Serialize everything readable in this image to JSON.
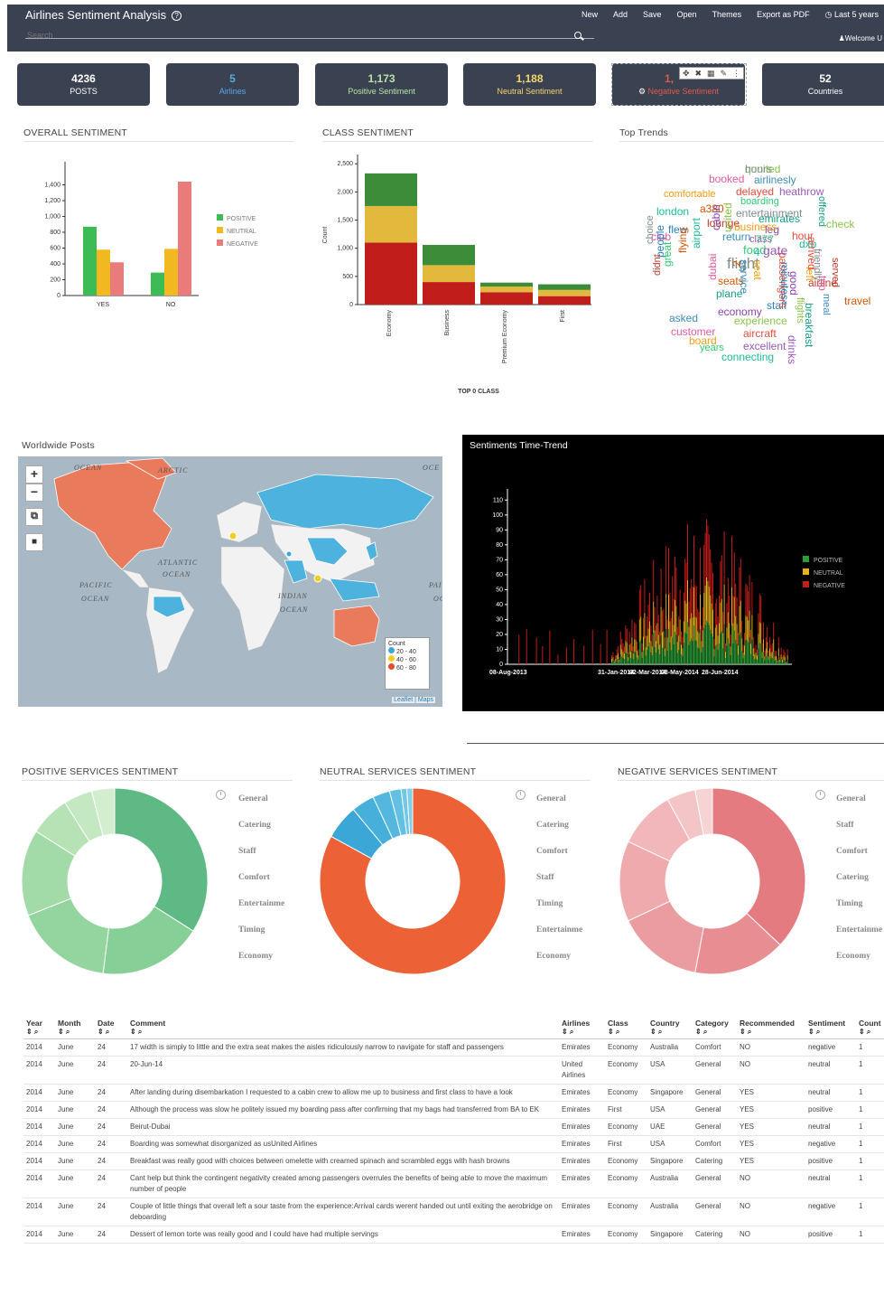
{
  "app": {
    "title": "Airlines Sentiment Analysis",
    "search_placeholder": "Search",
    "welcome": "Welcome U"
  },
  "menu": [
    "New",
    "Add",
    "Save",
    "Open",
    "Themes",
    "Export as PDF",
    "Last 5 years"
  ],
  "kpis": [
    {
      "value": "4236",
      "label": "POSTS",
      "style": "w"
    },
    {
      "value": "5",
      "label": "Airlines",
      "style": "b"
    },
    {
      "value": "1,173",
      "label": "Positive Sentiment",
      "style": "g"
    },
    {
      "value": "1,188",
      "label": "Neutral Sentiment",
      "style": "y"
    },
    {
      "value": "1,",
      "label": "Negative Sentiment",
      "style": "r"
    },
    {
      "value": "52",
      "label": "Countries",
      "style": "w"
    }
  ],
  "kpi_tools": [
    "✥",
    "✖",
    "▦",
    "✎",
    "⋮"
  ],
  "panels": {
    "overall": "OVERALL SENTIMENT",
    "class": "CLASS SENTIMENT",
    "trends": "Top Trends",
    "map": "Worldwide Posts",
    "timetrend": "Sentiments Time-Trend",
    "pos_services": "POSITIVE SERVICES SENTIMENT",
    "neu_services": "NEUTRAL SERVICES SENTIMENT",
    "neg_services": "NEGATIVE SERVICES SENTIMENT"
  },
  "colors": {
    "positive": "#3dbb54",
    "neutral": "#f2b81f",
    "negative": "#e0423a",
    "overall_negative": "#e97c7a",
    "class_positive": "#3c8c3a",
    "class_neutral": "#e3b93d",
    "class_negative": "#c11d1a"
  },
  "chart_data": [
    {
      "type": "bar",
      "title": "OVERALL SENTIMENT",
      "categories": [
        "YES",
        "NO"
      ],
      "series": [
        {
          "name": "POSITIVE",
          "values": [
            870,
            290
          ]
        },
        {
          "name": "NEUTRAL",
          "values": [
            580,
            590
          ]
        },
        {
          "name": "NEGATIVE",
          "values": [
            420,
            1440
          ]
        }
      ],
      "yticks": [
        "0",
        "200",
        "400",
        "600",
        "800",
        "1,000",
        "1,200",
        "1,400"
      ],
      "ylim": [
        0,
        1600
      ]
    },
    {
      "type": "bar",
      "title": "CLASS SENTIMENT",
      "stacked": true,
      "xlabel": "TOP 0 CLASS",
      "ylabel": "Count",
      "categories": [
        "Economy",
        "Business",
        "Premium Economy",
        "First"
      ],
      "series": [
        {
          "name": "NEGATIVE",
          "values": [
            1100,
            400,
            220,
            150
          ]
        },
        {
          "name": "NEUTRAL",
          "values": [
            650,
            300,
            100,
            110
          ]
        },
        {
          "name": "POSITIVE",
          "values": [
            580,
            360,
            70,
            100
          ]
        }
      ],
      "yticks": [
        "0",
        "500",
        "1,000",
        "1,500",
        "2,000",
        "2,500"
      ],
      "ylim": [
        0,
        2600
      ]
    },
    {
      "type": "bar",
      "title": "Sentiments Time-Trend",
      "stacked": true,
      "yticks": [
        "0",
        "10",
        "20",
        "30",
        "40",
        "50",
        "60",
        "70",
        "80",
        "90",
        "100",
        "110"
      ],
      "ylim": [
        0,
        115
      ],
      "xticks": [
        "08-Aug-2013",
        "31-Jan-2014",
        "02-Mar-2014",
        "08-May-2014",
        "28-Jun-2014"
      ],
      "series_names": [
        "POSITIVE",
        "NEUTRAL",
        "NEGATIVE"
      ]
    },
    {
      "type": "pie",
      "title": "POSITIVE SERVICES SENTIMENT",
      "labels": [
        "General",
        "Catering",
        "Staff",
        "Comfort",
        "Entertainme",
        "Timing",
        "Economy"
      ],
      "values": [
        34,
        18,
        17,
        15,
        7,
        5,
        4
      ],
      "colors": [
        "#5fb984",
        "#86cf96",
        "#94d49e",
        "#a3dba8",
        "#b6e2b5",
        "#c4e8c2",
        "#d2eecf"
      ]
    },
    {
      "type": "pie",
      "title": "NEUTRAL SERVICES SENTIMENT",
      "labels": [
        "General",
        "Catering",
        "Comfort",
        "Staff",
        "Timing",
        "Entertainme",
        "Economy"
      ],
      "values": [
        83,
        6,
        4,
        3,
        2,
        1,
        1
      ],
      "colors": [
        "#ec6136",
        "#3aa7d6",
        "#47b0da",
        "#54b8de",
        "#62c0e2",
        "#70c8e6",
        "#7ed0ea"
      ]
    },
    {
      "type": "pie",
      "title": "NEGATIVE SERVICES SENTIMENT",
      "labels": [
        "General",
        "Staff",
        "Comfort",
        "Catering",
        "Timing",
        "Entertainme",
        "Economy"
      ],
      "values": [
        37,
        16,
        15,
        14,
        10,
        5,
        3
      ],
      "colors": [
        "#e47b81",
        "#e88e92",
        "#eb9ca0",
        "#eeaaad",
        "#f1b7ba",
        "#f4c5c7",
        "#f7d3d4"
      ]
    }
  ],
  "map": {
    "labels": [
      "OCEAN",
      "OCE",
      "ATLANTIC",
      "OCEAN",
      "PACIFIC",
      "OCEAN",
      "INDIAN",
      "OCEAN",
      "ARCTIC",
      "PAI",
      "OC"
    ],
    "legend_title": "Count",
    "legend": [
      {
        "label": "20 - 40",
        "color": "#3aa7d6"
      },
      {
        "label": "40 - 60",
        "color": "#f2cf1f"
      },
      {
        "label": "60 - 80",
        "color": "#e84b2a"
      }
    ],
    "attribution": "Leaflet | Maps",
    "controls": [
      "+",
      "−",
      "⧉",
      "■"
    ]
  },
  "wordcloud": [
    "qunited",
    "booked",
    "airlinesly",
    "comfortable",
    "delayed",
    "heathrow",
    "boarding",
    "london",
    "a380",
    "entertainment",
    "lounge",
    "emirates",
    "flew",
    "leg",
    "check",
    "club",
    "return",
    "business",
    "hour",
    "class",
    "food",
    "dxb",
    "seats",
    "flight",
    "airline",
    "plane",
    "staff",
    "economy",
    "experience",
    "customer",
    "asked",
    "board",
    "aircraft",
    "excellent",
    "years",
    "connecting",
    "travel",
    "friendly",
    "served",
    "breakfast",
    "people",
    "cabin",
    "united",
    "dubai",
    "service",
    "seat",
    "passengers",
    "drinks",
    "great",
    "airport",
    "flying",
    "choice",
    "didnt",
    "offered",
    "minutes",
    "good",
    "flights",
    "trip",
    "meal",
    "left",
    "arrived",
    "gate",
    "777",
    "4",
    "2",
    "hours"
  ],
  "table": {
    "headers": [
      "Year",
      "Month",
      "Date",
      "Comment",
      "Airlines",
      "Class",
      "Country",
      "Category",
      "Recommended",
      "Sentiment",
      "Count"
    ],
    "rows": [
      [
        "2014",
        "June",
        "24",
        "17 width is simply to little and the extra seat makes the aisles ridiculously narrow to navigate for staff and passengers",
        "Emirates",
        "Economy",
        "Australia",
        "Comfort",
        "NO",
        "negative",
        "1"
      ],
      [
        "2014",
        "June",
        "24",
        "20-Jun-14",
        "United Airlines",
        "Economy",
        "USA",
        "General",
        "NO",
        "neutral",
        "1"
      ],
      [
        "2014",
        "June",
        "24",
        "After landing during disembarkation I requested to a cabin crew to allow me up to business and first class to have a look",
        "Emirates",
        "Economy",
        "Singapore",
        "General",
        "YES",
        "neutral",
        "1"
      ],
      [
        "2014",
        "June",
        "24",
        "Although the process was slow he politely issued my boarding pass after confirming that my bags had transferred from BA to EK",
        "Emirates",
        "First",
        "USA",
        "General",
        "YES",
        "positive",
        "1"
      ],
      [
        "2014",
        "June",
        "24",
        "Beirut-Dubai",
        "Emirates",
        "Economy",
        "UAE",
        "General",
        "YES",
        "neutral",
        "1"
      ],
      [
        "2014",
        "June",
        "24",
        "Boarding was somewhat disorganized as usUnited Airlines",
        "Emirates",
        "First",
        "USA",
        "Comfort",
        "YES",
        "negative",
        "1"
      ],
      [
        "2014",
        "June",
        "24",
        "Breakfast was really good with choices between omelette with creamed spinach and scrambled eggs with hash browns",
        "Emirates",
        "Economy",
        "Singapore",
        "Catering",
        "YES",
        "positive",
        "1"
      ],
      [
        "2014",
        "June",
        "24",
        "Cant help but think the contingent negativity created among passengers overrules the benefits of being able to move the maximum number of people",
        "Emirates",
        "Economy",
        "Australia",
        "General",
        "NO",
        "neutral",
        "1"
      ],
      [
        "2014",
        "June",
        "24",
        "Couple of little things that overall left a sour taste from the experience:Arrival cards werent handed out until exiting the aerobridge on deboarding",
        "Emirates",
        "Economy",
        "Australia",
        "General",
        "NO",
        "negative",
        "1"
      ],
      [
        "2014",
        "June",
        "24",
        "Dessert of lemon torte was really good and I could have had multiple servings",
        "Emirates",
        "Economy",
        "Singapore",
        "Catering",
        "NO",
        "positive",
        "1"
      ]
    ]
  }
}
